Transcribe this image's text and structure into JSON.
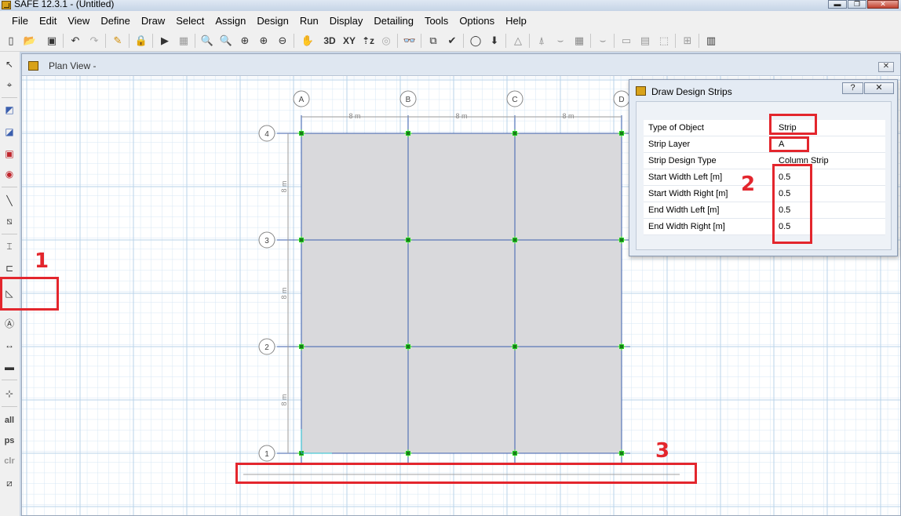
{
  "window": {
    "title": "SAFE 12.3.1 - (Untitled)",
    "minimize_label": "▬",
    "restore_label": "❐",
    "close_label": "✕"
  },
  "menu": [
    "File",
    "Edit",
    "View",
    "Define",
    "Draw",
    "Select",
    "Assign",
    "Design",
    "Run",
    "Display",
    "Detailing",
    "Tools",
    "Options",
    "Help"
  ],
  "toolbar": {
    "label_3d": "3D",
    "label_xy": "XY",
    "label_z": "⇡z"
  },
  "left_toolbar": {
    "label_all": "all",
    "label_ps": "ps",
    "label_clr": "clr"
  },
  "plan_view": {
    "title": "Plan View -",
    "close_label": "✕",
    "grid_x_labels": [
      "A",
      "B",
      "C",
      "D"
    ],
    "grid_y_labels": [
      "4",
      "3",
      "2",
      "1"
    ],
    "spacing_labels": [
      "8 m",
      "8 m",
      "8 m"
    ],
    "vertical_spacing_labels": [
      "8 m",
      "8 m",
      "8 m"
    ]
  },
  "dialog": {
    "title": "Draw Design Strips",
    "help_label": "?",
    "close_label": "✕",
    "rows": [
      {
        "label": "Type of Object",
        "value": "Strip"
      },
      {
        "label": "Strip Layer",
        "value": "A"
      },
      {
        "label": "Strip Design Type",
        "value": "Column Strip"
      },
      {
        "label": "Start Width Left  [m]",
        "value": "0.5"
      },
      {
        "label": "Start Width Right  [m]",
        "value": "0.5"
      },
      {
        "label": "End Width Left  [m]",
        "value": "0.5"
      },
      {
        "label": "End Width Right  [m]",
        "value": "0.5"
      }
    ]
  },
  "annotations": {
    "n1": "1",
    "n2": "2",
    "n3": "3"
  },
  "colors": {
    "annotation": "#e3262d",
    "slab": "#d9d9dc",
    "grid_line": "#3b5fae",
    "point": "#22cc22"
  }
}
